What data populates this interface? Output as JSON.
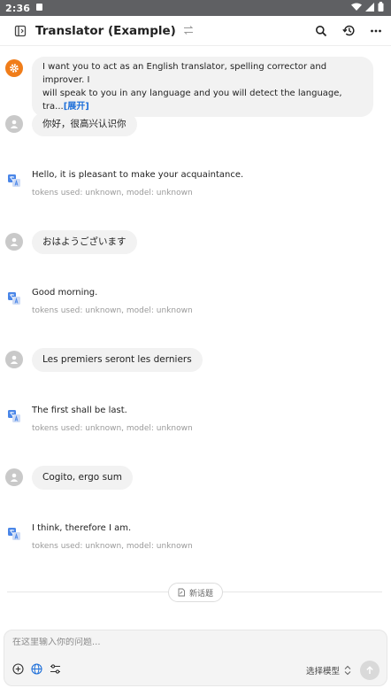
{
  "status_bar": {
    "time": "2:36"
  },
  "app_bar": {
    "title": "Translator (Example)"
  },
  "chat": {
    "system_prompt": {
      "text_line1": "I want you to act as an English translator, spelling corrector and improver. I",
      "text_line2": "will speak to you in any language and you will detect the language, tra...",
      "expand_label": "[展开]"
    },
    "messages": [
      {
        "role": "user",
        "text": "你好，很高兴认识你"
      },
      {
        "role": "bot",
        "text": "Hello, it is pleasant to make your acquaintance.",
        "meta": "tokens used: unknown, model: unknown"
      },
      {
        "role": "user",
        "text": "おはようございます"
      },
      {
        "role": "bot",
        "text": "Good morning.",
        "meta": "tokens used: unknown, model: unknown"
      },
      {
        "role": "user",
        "text": "Les premiers seront les derniers"
      },
      {
        "role": "bot",
        "text": "The first shall be last.",
        "meta": "tokens used: unknown, model: unknown"
      },
      {
        "role": "user",
        "text": "Cogito, ergo sum"
      },
      {
        "role": "bot",
        "text": "I think, therefore I am.",
        "meta": "tokens used: unknown, model: unknown"
      }
    ]
  },
  "topic": {
    "new_topic_label": "新话题"
  },
  "composer": {
    "placeholder": "在这里输入你的问题...",
    "value": "",
    "model_select_label": "选择模型"
  },
  "colors": {
    "system_avatar": "#f07d1a",
    "user_avatar": "#c9c9c9",
    "link": "#1e6fd9",
    "status_bar": "#5f6063"
  }
}
